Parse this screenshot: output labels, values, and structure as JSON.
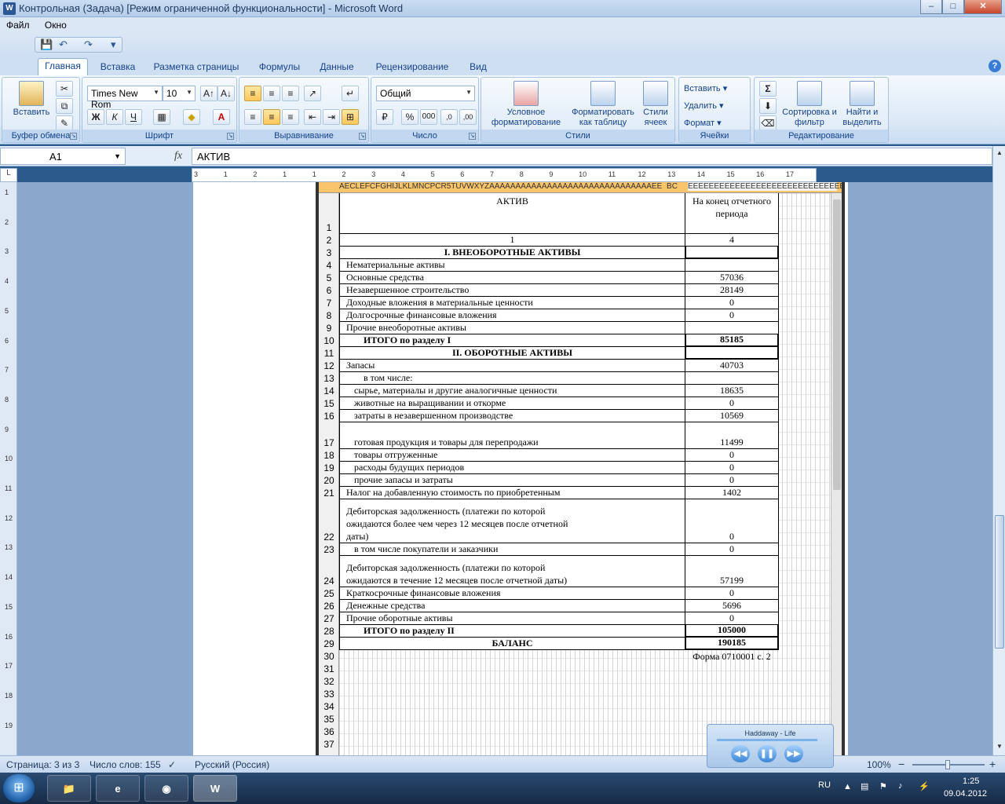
{
  "window": {
    "title": "Контрольная (Задача) [Режим ограниченной функциональности] - Microsoft Word",
    "minimize": "–",
    "maximize": "□",
    "close": "✕",
    "app_icon": "W"
  },
  "menu": {
    "items": [
      "Файл",
      "Окно"
    ]
  },
  "qat": {
    "save": "💾",
    "undo": "↶",
    "redo": "↷",
    "more": "▾"
  },
  "tabs": {
    "items": [
      "Главная",
      "Вставка",
      "Разметка страницы",
      "Формулы",
      "Данные",
      "Рецензирование",
      "Вид"
    ],
    "active": 0
  },
  "ribbon": {
    "clipboard": {
      "label": "Буфер обмена",
      "paste": "Вставить"
    },
    "font": {
      "label": "Шрифт",
      "name": "Times New Rom",
      "size": "10",
      "bold": "Ж",
      "italic": "К",
      "underline": "Ч"
    },
    "alignment": {
      "label": "Выравнивание"
    },
    "number": {
      "label": "Число",
      "format": "Общий",
      "percent": "%",
      "thousands": "000"
    },
    "styles": {
      "label": "Стили",
      "conditional": "Условное форматирование",
      "as_table": "Форматировать как таблицу",
      "cell_styles": "Стили ячеек"
    },
    "cells": {
      "label": "Ячейки",
      "insert": "Вставить",
      "delete": "Удалить",
      "format": "Формат"
    },
    "editing": {
      "label": "Редактирование",
      "sum": "Σ",
      "sort": "Сортировка и фильтр",
      "find": "Найти и выделить"
    }
  },
  "formula_bar": {
    "name_box": "A1",
    "fx": "fx",
    "content": "АКТИВ"
  },
  "ruler": {
    "ticks": [
      "3",
      "1",
      "2",
      "1",
      "1",
      "2",
      "3",
      "4",
      "5",
      "6",
      "7",
      "8",
      "9",
      "10",
      "11",
      "12",
      "13",
      "14",
      "15",
      "16",
      "17"
    ]
  },
  "vruler": {
    "ticks": [
      "1",
      "2",
      "3",
      "4",
      "5",
      "6",
      "7",
      "8",
      "9",
      "10",
      "11",
      "12",
      "13",
      "14",
      "15",
      "16",
      "17",
      "18",
      "19"
    ]
  },
  "sheet": {
    "header_left": "AECLEFCFGHIJLKLMNCPCR5TUVWXYZAAAAAAAAAAAAAAAAAAAAAAAAAAAAAAAEE",
    "header_mid": "BC",
    "header_right": "EEEEEEEEEEEEEEEEEEEEEEEEEEEEEEEEEEEEEECCCCCC",
    "col_header_activ": "АКТИВ",
    "col_header_period": "На конец отчетного периода",
    "rows": [
      {
        "n": "1",
        "label": "",
        "value": ""
      },
      {
        "n": "2",
        "label": "1",
        "value": "4"
      },
      {
        "n": "3",
        "label": "I. ВНЕОБОРОТНЫЕ АКТИВЫ",
        "value": ""
      },
      {
        "n": "4",
        "label": "Нематериальные активы",
        "value": ""
      },
      {
        "n": "5",
        "label": "Основные средства",
        "value": "57036"
      },
      {
        "n": "6",
        "label": "Незавершенное строительство",
        "value": "28149"
      },
      {
        "n": "7",
        "label": "Доходные вложения в материальные ценности",
        "value": "0"
      },
      {
        "n": "8",
        "label": "Долгосрочные финансовые вложения",
        "value": "0"
      },
      {
        "n": "9",
        "label": "Прочие внеоборотные активы",
        "value": ""
      },
      {
        "n": "10",
        "label": "ИТОГО по разделу I",
        "value": "85185"
      },
      {
        "n": "11",
        "label": "II. ОБОРОТНЫЕ АКТИВЫ",
        "value": ""
      },
      {
        "n": "12",
        "label": "Запасы",
        "value": "40703"
      },
      {
        "n": "13",
        "label": "в том числе:",
        "value": ""
      },
      {
        "n": "14",
        "label": "сырье, материалы и другие аналогичные ценности",
        "value": "18635"
      },
      {
        "n": "15",
        "label": "животные на выращивании и откорме",
        "value": "0"
      },
      {
        "n": "16",
        "label": "затраты в незавершенном производстве",
        "value": "10569"
      },
      {
        "n": "17",
        "label": "готовая продукция и товары для перепродажи",
        "value": "11499"
      },
      {
        "n": "18",
        "label": "товары отгруженные",
        "value": "0"
      },
      {
        "n": "19",
        "label": "расходы будущих периодов",
        "value": "0"
      },
      {
        "n": "20",
        "label": "прочие запасы и затраты",
        "value": "0"
      },
      {
        "n": "21",
        "label": "Налог на добавленную стоимость по приобретенным",
        "value": "1402"
      },
      {
        "n": "22",
        "label": "Дебиторская задолженность (платежи по которой ожидаются более чем через 12 месяцев после отчетной даты)",
        "value": "0"
      },
      {
        "n": "23",
        "label": "в том числе покупатели и заказчики",
        "value": "0"
      },
      {
        "n": "24",
        "label": "Дебиторская задолженность (платежи по которой ожидаются в течение 12 месяцев после отчетной даты)",
        "value": "57199"
      },
      {
        "n": "25",
        "label": "Краткосрочные финансовые вложения",
        "value": "0"
      },
      {
        "n": "26",
        "label": "Денежные средства",
        "value": "5696"
      },
      {
        "n": "27",
        "label": "Прочие оборотные активы",
        "value": "0"
      },
      {
        "n": "28",
        "label": "ИТОГО по разделу II",
        "value": "105000"
      },
      {
        "n": "29",
        "label": "БАЛАНС",
        "value": "190185"
      },
      {
        "n": "30",
        "label": "",
        "value": "Форма 0710001 с. 2"
      },
      {
        "n": "31",
        "label": "",
        "value": ""
      },
      {
        "n": "32",
        "label": "",
        "value": ""
      },
      {
        "n": "33",
        "label": "",
        "value": ""
      },
      {
        "n": "34",
        "label": "",
        "value": ""
      },
      {
        "n": "35",
        "label": "",
        "value": ""
      },
      {
        "n": "36",
        "label": "",
        "value": ""
      },
      {
        "n": "37",
        "label": "",
        "value": ""
      }
    ]
  },
  "status": {
    "page": "Страница: 3 из 3",
    "words": "Число слов: 155",
    "language": "Русский (Россия)",
    "zoom": "100%",
    "zoom_out": "−",
    "zoom_in": "+"
  },
  "media": {
    "track": "Haddaway - Life",
    "prev": "◀◀",
    "pause": "❚❚",
    "next": "▶▶"
  },
  "taskbar": {
    "lang": "RU",
    "time": "1:25",
    "date": "09.04.2012",
    "word_label": "W",
    "ie_label": "e"
  }
}
